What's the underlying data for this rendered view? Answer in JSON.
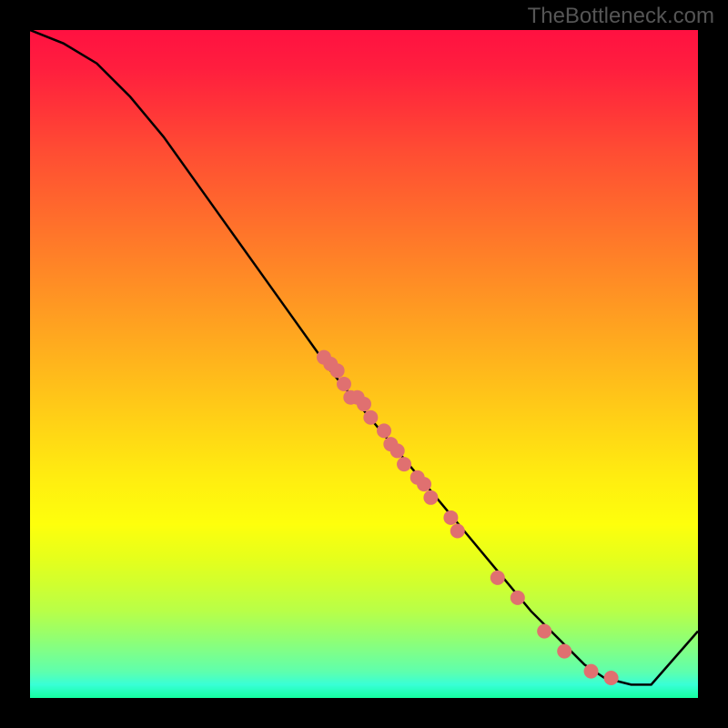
{
  "watermark": "TheBottleneck.com",
  "chart_data": {
    "type": "line",
    "title": "",
    "xlabel": "",
    "ylabel": "",
    "xlim": [
      0,
      100
    ],
    "ylim": [
      0,
      100
    ],
    "series": [
      {
        "name": "curve",
        "x": [
          0,
          5,
          10,
          15,
          20,
          25,
          30,
          35,
          40,
          45,
          50,
          55,
          60,
          65,
          70,
          75,
          80,
          83,
          86,
          90,
          93,
          100
        ],
        "y": [
          100,
          98,
          95,
          90,
          84,
          77,
          70,
          63,
          56,
          49,
          43,
          37,
          31,
          25,
          19,
          13,
          8,
          5,
          3,
          2,
          2,
          10
        ]
      }
    ],
    "scatter_points": [
      {
        "x": 44,
        "y": 51
      },
      {
        "x": 45,
        "y": 50
      },
      {
        "x": 46,
        "y": 49
      },
      {
        "x": 47,
        "y": 47
      },
      {
        "x": 48,
        "y": 45
      },
      {
        "x": 49,
        "y": 45
      },
      {
        "x": 50,
        "y": 44
      },
      {
        "x": 51,
        "y": 42
      },
      {
        "x": 53,
        "y": 40
      },
      {
        "x": 54,
        "y": 38
      },
      {
        "x": 55,
        "y": 37
      },
      {
        "x": 56,
        "y": 35
      },
      {
        "x": 58,
        "y": 33
      },
      {
        "x": 59,
        "y": 32
      },
      {
        "x": 60,
        "y": 30
      },
      {
        "x": 63,
        "y": 27
      },
      {
        "x": 64,
        "y": 25
      },
      {
        "x": 70,
        "y": 18
      },
      {
        "x": 73,
        "y": 15
      },
      {
        "x": 77,
        "y": 10
      },
      {
        "x": 80,
        "y": 7
      },
      {
        "x": 84,
        "y": 4
      },
      {
        "x": 87,
        "y": 3
      }
    ],
    "colors": {
      "line": "#000000",
      "points": "#e07070"
    }
  }
}
